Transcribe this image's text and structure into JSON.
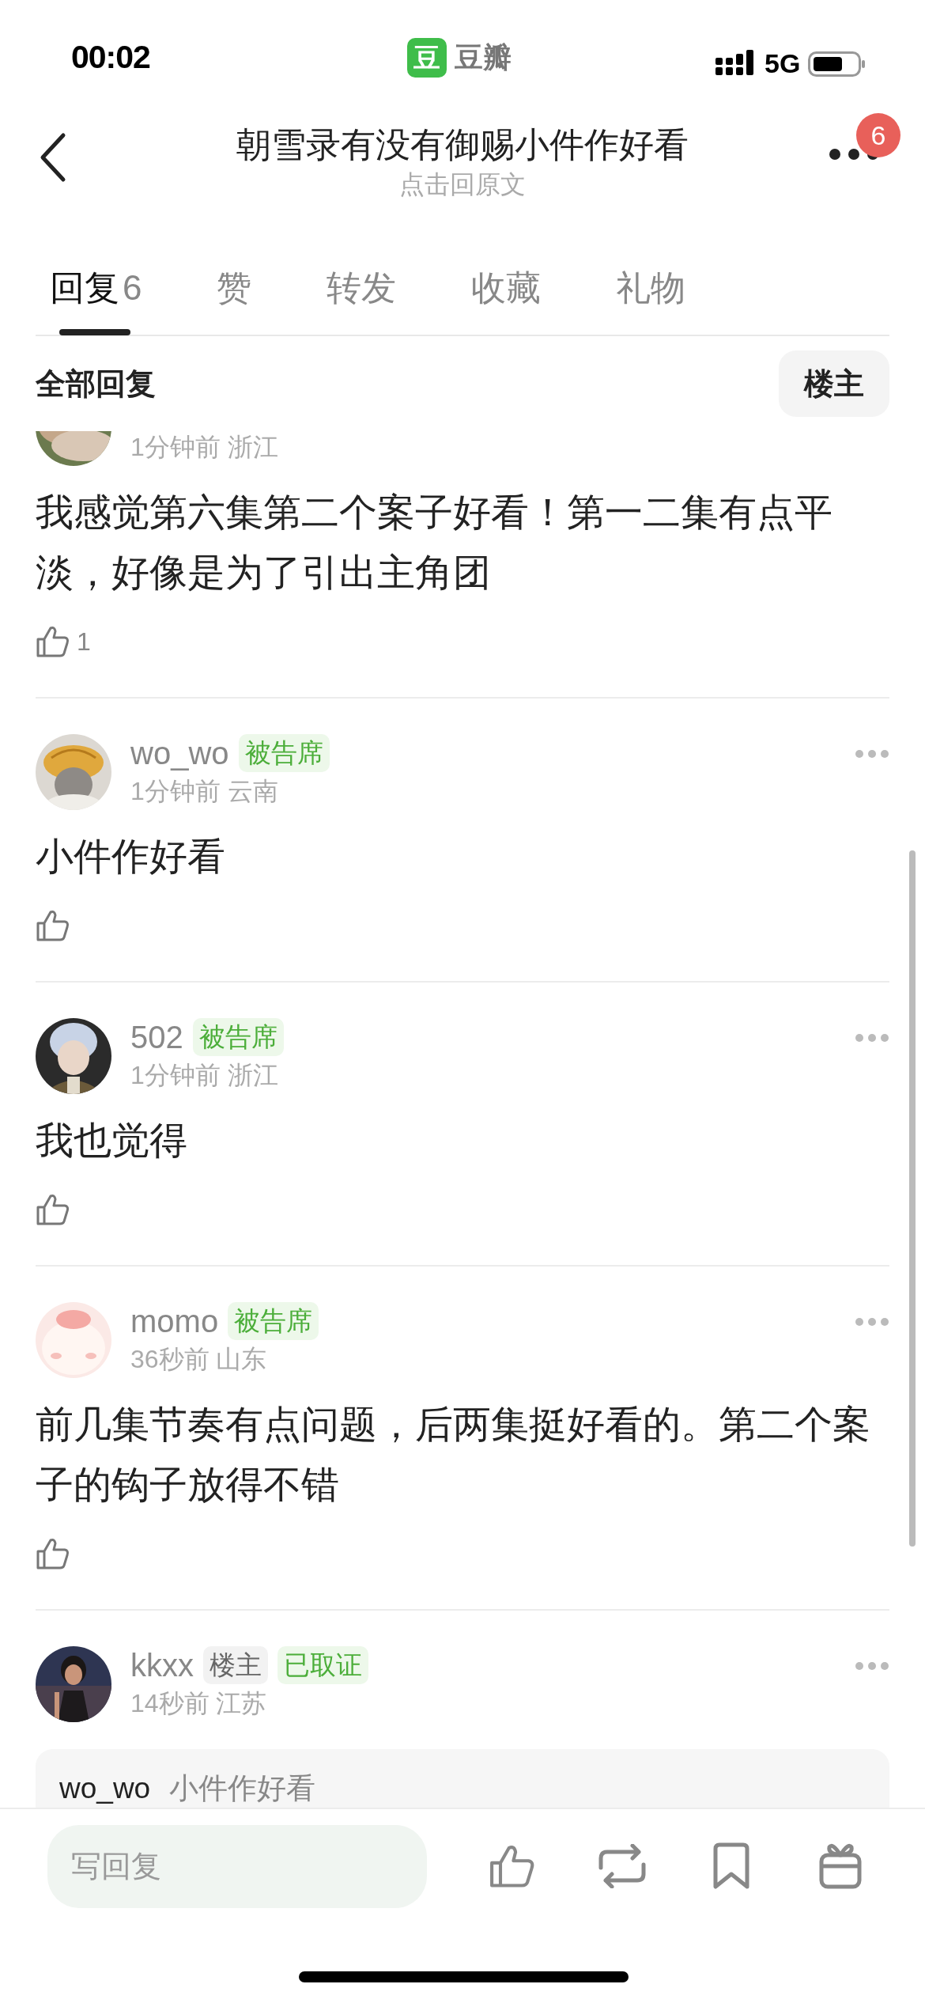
{
  "status_bar": {
    "time": "00:02",
    "app_name": "豆瓣",
    "app_icon_glyph": "豆",
    "network": "5G"
  },
  "nav": {
    "title": "朝雪录有没有御赐小件作好看",
    "subtitle": "点击回原文",
    "badge": "6"
  },
  "tabs": [
    {
      "label": "回复",
      "count": "6",
      "selected": true
    },
    {
      "label": "赞",
      "selected": false
    },
    {
      "label": "转发",
      "selected": false
    },
    {
      "label": "收藏",
      "selected": false
    },
    {
      "label": "礼物",
      "selected": false
    }
  ],
  "section": {
    "title": "全部回复",
    "filter_button": "楼主"
  },
  "comments": [
    {
      "meta": "1分钟前 浙江",
      "text": "我感觉第六集第二个案子好看！第一二集有点平淡，好像是为了引出主角团",
      "likes": "1"
    },
    {
      "name": "wo_wo",
      "tags": [
        {
          "label": "被告席",
          "kind": "accent"
        }
      ],
      "meta": "1分钟前 云南",
      "text": "小件作好看"
    },
    {
      "name": "502",
      "tags": [
        {
          "label": "被告席",
          "kind": "accent"
        }
      ],
      "meta": "1分钟前 浙江",
      "text": "我也觉得"
    },
    {
      "name": "momo",
      "tags": [
        {
          "label": "被告席",
          "kind": "accent"
        }
      ],
      "meta": "36秒前 山东",
      "text": "前几集节奏有点问题，后两集挺好看的。第二个案子的钩子放得不错"
    },
    {
      "name": "kkxx",
      "tags": [
        {
          "label": "楼主",
          "kind": "plain"
        },
        {
          "label": "已取证",
          "kind": "accent"
        }
      ],
      "meta": "14秒前 江苏",
      "quote": {
        "name": "wo_wo",
        "text": "小件作好看"
      }
    }
  ],
  "composer": {
    "placeholder": "写回复"
  }
}
